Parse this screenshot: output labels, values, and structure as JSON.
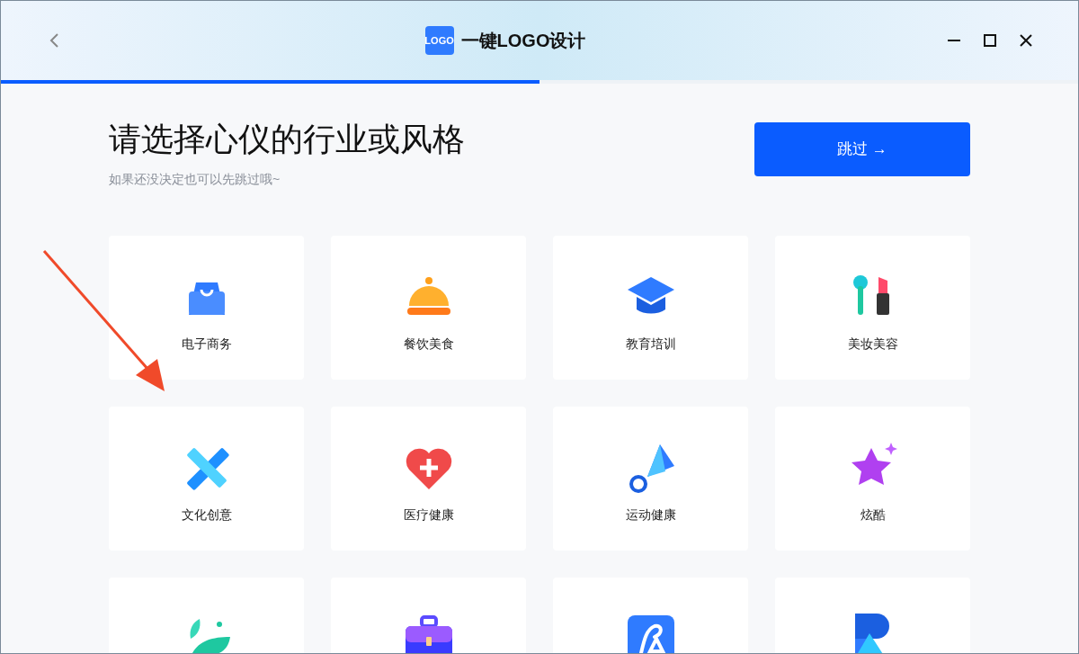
{
  "window": {
    "logo_text": "LOGO",
    "title": "一键LOGO设计"
  },
  "progress": {
    "level": 0.5
  },
  "heading": "请选择心仪的行业或风格",
  "subtitle": "如果还没决定也可以先跳过哦~",
  "skip_button": "跳过 →",
  "categories": [
    {
      "kind": "bag",
      "label": "电子商务"
    },
    {
      "kind": "cloche",
      "label": "餐饮美食"
    },
    {
      "kind": "cap",
      "label": "教育培训"
    },
    {
      "kind": "lipstick",
      "label": "美妆美容"
    },
    {
      "kind": "pencil",
      "label": "文化创意"
    },
    {
      "kind": "heart",
      "label": "医疗健康"
    },
    {
      "kind": "shuttlecock",
      "label": "运动健康"
    },
    {
      "kind": "star",
      "label": "炫酷"
    },
    {
      "kind": "leaf"
    },
    {
      "kind": "briefcase"
    },
    {
      "kind": "lettermark"
    },
    {
      "kind": "geometric"
    }
  ]
}
